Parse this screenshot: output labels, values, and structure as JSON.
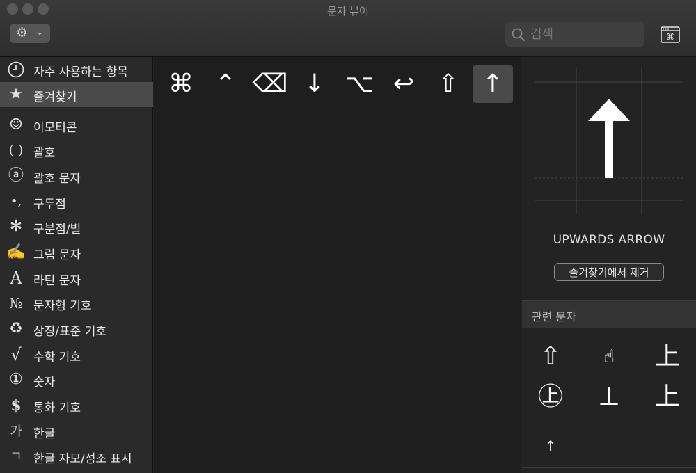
{
  "window": {
    "title": "문자 뷰어"
  },
  "toolbar": {
    "gear_icon": "gear-icon",
    "chevron": "⌄",
    "search_placeholder": "검색",
    "search_value": "",
    "keyboard_viewer_icon": "keyboard-viewer-icon"
  },
  "sidebar": {
    "items": [
      {
        "icon": "clock-icon",
        "glyph": "🕘",
        "label": "자주 사용하는 항목"
      },
      {
        "icon": "star-icon",
        "glyph": "★",
        "label": "즐겨찾기"
      },
      {
        "icon": "smiley-icon",
        "glyph": "☺",
        "label": "이모티콘"
      },
      {
        "icon": "parentheses-icon",
        "glyph": "( )",
        "label": "괄호"
      },
      {
        "icon": "circled-a-icon",
        "glyph": "ⓐ",
        "label": "괄호 문자"
      },
      {
        "icon": "punctuation-icon",
        "glyph": "•,",
        "label": "구두점"
      },
      {
        "icon": "asterisk-icon",
        "glyph": "✻",
        "label": "구분점/별"
      },
      {
        "icon": "writing-hand-icon",
        "glyph": "✍",
        "label": "그림 문자"
      },
      {
        "icon": "latin-a-icon",
        "glyph": "A",
        "label": "라틴 문자"
      },
      {
        "icon": "numero-icon",
        "glyph": "№",
        "label": "문자형 기호"
      },
      {
        "icon": "recycle-icon",
        "glyph": "♻",
        "label": "상징/표준 기호"
      },
      {
        "icon": "square-root-icon",
        "glyph": "√",
        "label": "수학 기호"
      },
      {
        "icon": "circled-one-icon",
        "glyph": "①",
        "label": "숫자"
      },
      {
        "icon": "dollar-icon",
        "glyph": "$",
        "label": "통화 기호"
      },
      {
        "icon": "hangul-ga-icon",
        "glyph": "가",
        "label": "한글"
      },
      {
        "icon": "hangul-jamo-icon",
        "glyph": "ㄱ",
        "label": "한글 자모/성조 표시"
      }
    ],
    "selected_index": 1
  },
  "favorites": {
    "characters": [
      "⌘",
      "⌃",
      "⌫",
      "↓",
      "⌥",
      "↩",
      "⇧",
      "↑"
    ],
    "selected_index": 7
  },
  "detail": {
    "preview_glyph": "↑",
    "character_name": "UPWARDS ARROW",
    "remove_button_label": "즐겨찾기에서 제거",
    "related_header": "관련 문자",
    "related": [
      "⇧",
      "☝",
      "上",
      "㊤",
      "⊥",
      "上",
      "↑"
    ]
  }
}
